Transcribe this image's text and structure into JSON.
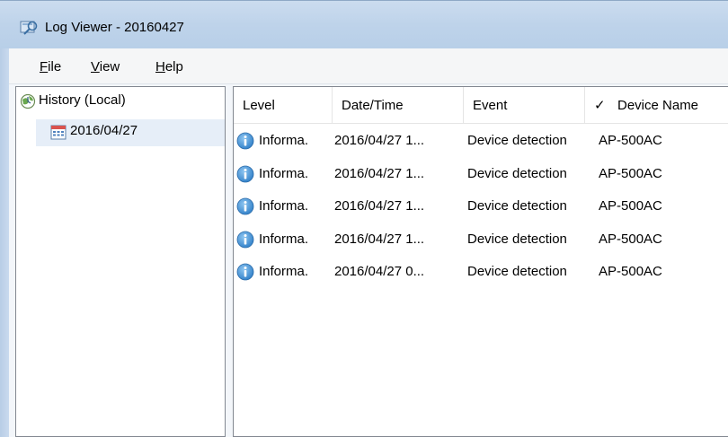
{
  "window": {
    "title": "Log Viewer - 20160427"
  },
  "menu": [
    {
      "accel": "F",
      "rest": "ile"
    },
    {
      "accel": "V",
      "rest": "iew"
    },
    {
      "accel": "H",
      "rest": "elp"
    }
  ],
  "tree": {
    "root_label": "History (Local)",
    "child_label": "2016/04/27"
  },
  "list": {
    "headers": {
      "level": "Level",
      "datetime": "Date/Time",
      "event": "Event",
      "check": "✓",
      "device": "Device Name"
    },
    "rows": [
      {
        "level": "Informa.",
        "datetime": "2016/04/27 1...",
        "event": "Device detection",
        "device": "AP-500AC"
      },
      {
        "level": "Informa.",
        "datetime": "2016/04/27 1...",
        "event": "Device detection",
        "device": "AP-500AC"
      },
      {
        "level": "Informa.",
        "datetime": "2016/04/27 1...",
        "event": "Device detection",
        "device": "AP-500AC"
      },
      {
        "level": "Informa.",
        "datetime": "2016/04/27 1...",
        "event": "Device detection",
        "device": "AP-500AC"
      },
      {
        "level": "Informa.",
        "datetime": "2016/04/27 0...",
        "event": "Device detection",
        "device": "AP-500AC"
      }
    ]
  },
  "icons": {
    "app": "log-viewer-icon",
    "tree_root": "history-globe-icon",
    "tree_child": "calendar-icon",
    "row": "information-icon"
  },
  "colors": {
    "titlebar": "#bed3ea",
    "selection": "#e6eef8",
    "info_icon": "#3c8fd6"
  }
}
